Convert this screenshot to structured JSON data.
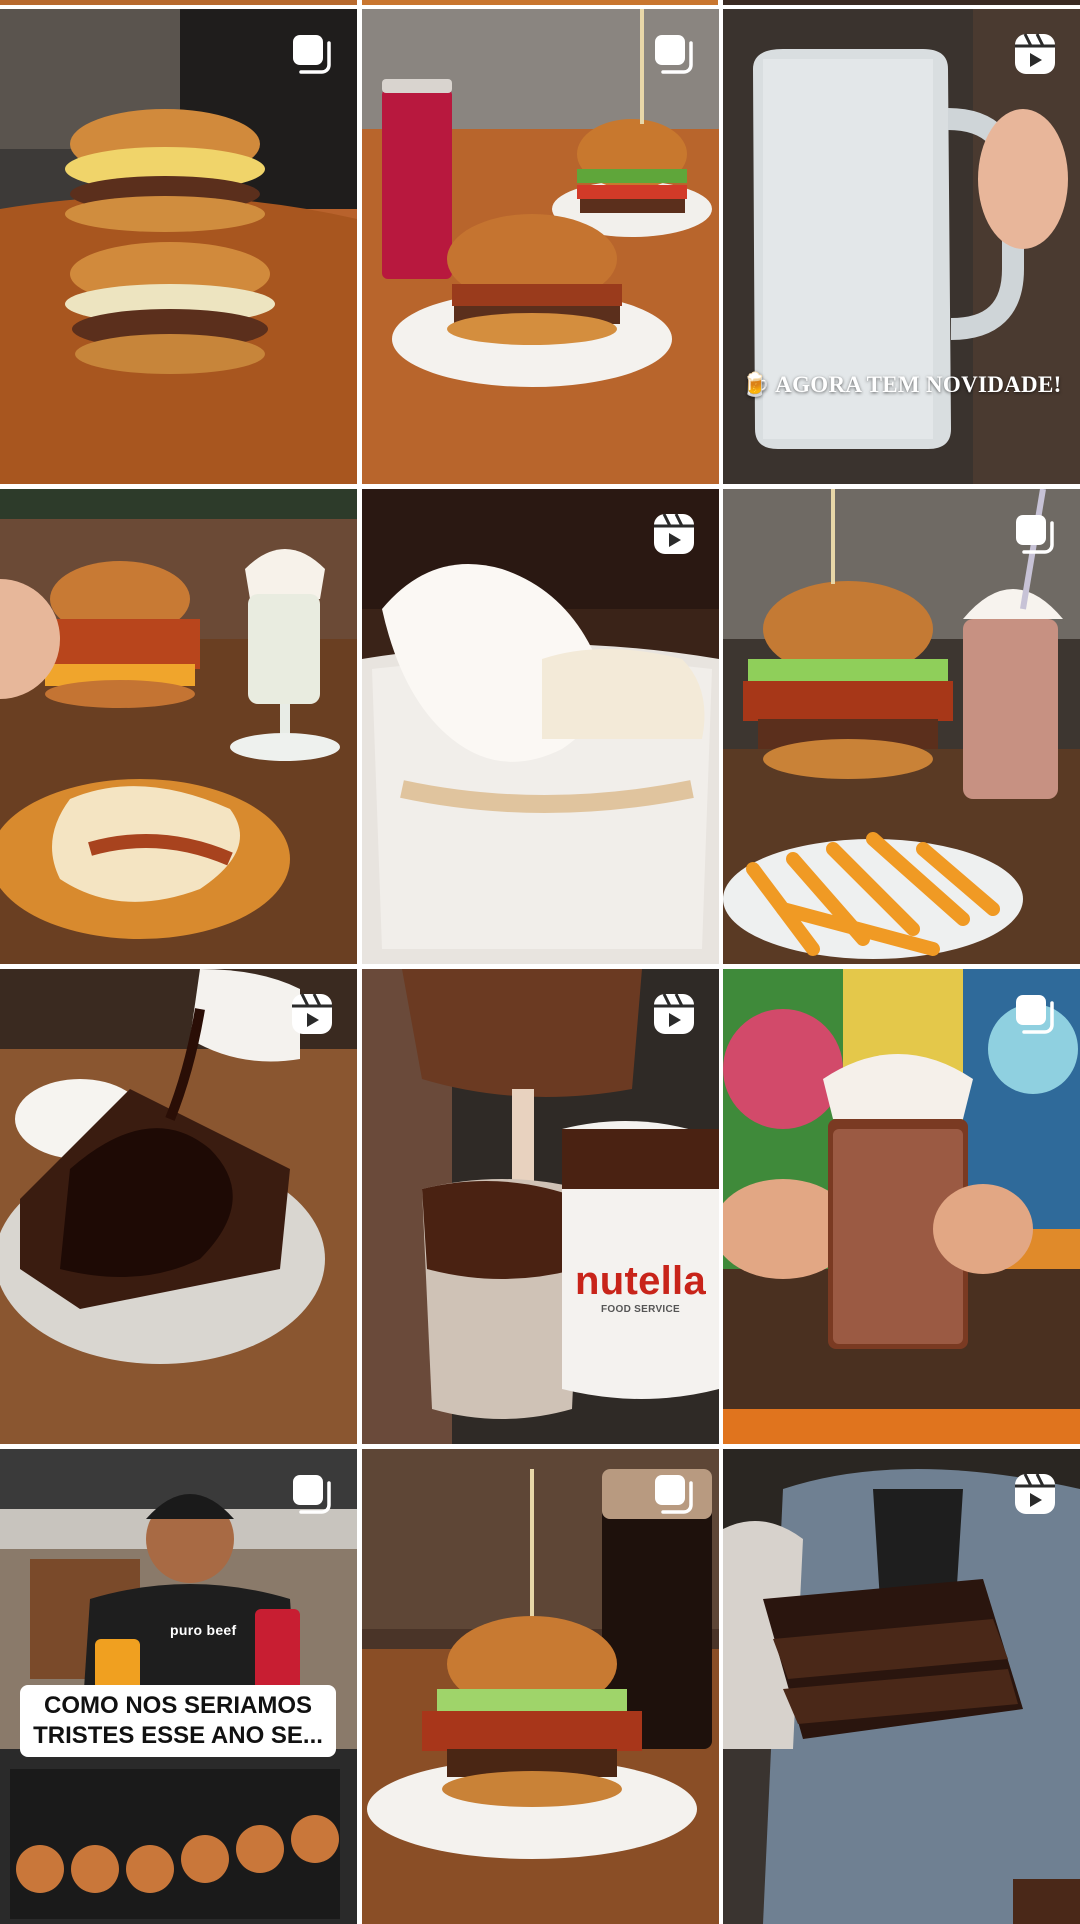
{
  "grid": {
    "posts": [
      {
        "kind": "carousel",
        "badge_icon": "carousel-icon",
        "subject": "stacked double burgers"
      },
      {
        "kind": "carousel",
        "badge_icon": "carousel-icon",
        "subject": "burgers and berry drink"
      },
      {
        "kind": "reel",
        "badge_icon": "reel-icon",
        "subject": "frosted beer mug",
        "caption": "🍺 AGORA TEM NOVIDADE!"
      },
      {
        "kind": "none",
        "badge_icon": "",
        "subject": "burger, fries and milkshake"
      },
      {
        "kind": "reel",
        "badge_icon": "reel-icon",
        "subject": "ice cream bowl"
      },
      {
        "kind": "carousel",
        "badge_icon": "carousel-icon",
        "subject": "bacon burger, fries and milkshake"
      },
      {
        "kind": "reel",
        "badge_icon": "reel-icon",
        "subject": "chocolate cake with sauce"
      },
      {
        "kind": "reel",
        "badge_icon": "reel-icon",
        "subject": "nutella milkshake pour",
        "brand_text": "nutella",
        "brand_sub": "FOOD SERVICE"
      },
      {
        "kind": "carousel",
        "badge_icon": "carousel-icon",
        "subject": "chocolate milkshake"
      },
      {
        "kind": "carousel",
        "badge_icon": "carousel-icon",
        "subject": "smiling man with food",
        "caption": "COMO NOS SERIAMOS TRISTES ESSE ANO SE...",
        "shirt_text": "puro beef"
      },
      {
        "kind": "carousel",
        "badge_icon": "carousel-icon",
        "subject": "bacon burger and cola"
      },
      {
        "kind": "reel",
        "badge_icon": "reel-icon",
        "subject": "layered chocolate cake"
      }
    ]
  }
}
